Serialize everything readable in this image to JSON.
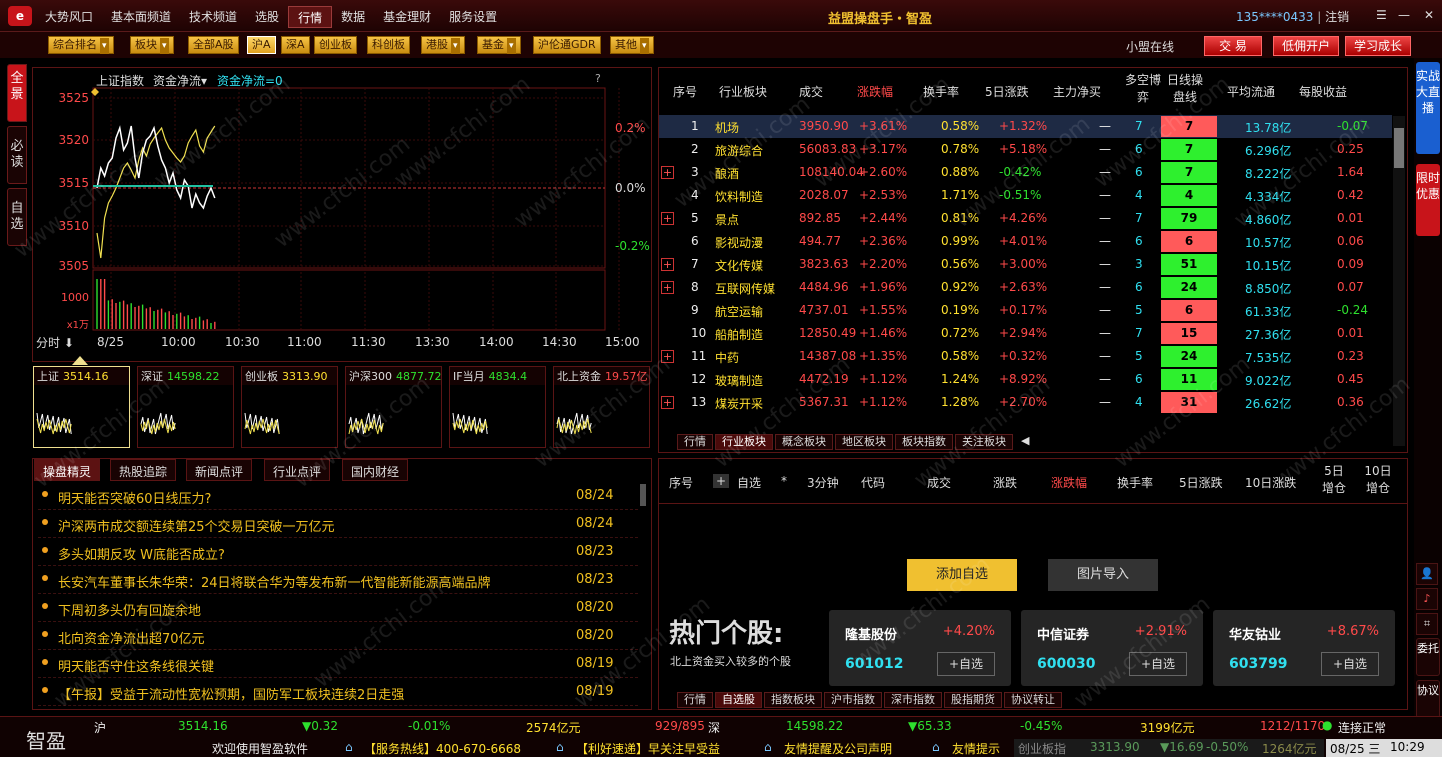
{
  "menu": [
    "大势风口",
    "基本面频道",
    "技术频道",
    "选股",
    "行情",
    "数据",
    "基金理财",
    "服务设置"
  ],
  "menu_active_index": 4,
  "app_title": "益盟操盘手・智盈",
  "user": {
    "account": "135****0433",
    "logout": "注销",
    "sep": "|"
  },
  "filters": [
    {
      "label": "综合排名",
      "arrow": true
    },
    {
      "label": "板块",
      "arrow": true
    },
    {
      "label": "全部A股",
      "arrow": false
    },
    {
      "label": "沪A",
      "arrow": false
    },
    {
      "label": "深A",
      "arrow": false
    },
    {
      "label": "创业板",
      "arrow": false
    },
    {
      "label": "科创板",
      "arrow": false
    },
    {
      "label": "港股",
      "arrow": true
    },
    {
      "label": "基金",
      "arrow": true
    },
    {
      "label": "沪伦通GDR",
      "arrow": false
    },
    {
      "label": "其他",
      "arrow": true
    }
  ],
  "top_right": {
    "online": "小盟在线",
    "trade": "交 易",
    "open": "低佣开户",
    "learn": "学习成长"
  },
  "left_tabs": [
    "全景",
    "必读",
    "自选"
  ],
  "chart": {
    "title": "上证指数",
    "indicator": "资金净流",
    "indicator_value": "资金净流=0",
    "help": "?",
    "y_left": [
      "3525",
      "3520",
      "3515",
      "3510",
      "3505"
    ],
    "y_right": [
      "0.2%",
      "0.0%",
      "-0.2%"
    ],
    "vol_label": "1000",
    "vol_unit": "x1万",
    "x_labels": [
      "8/25",
      "10:00",
      "10:30",
      "11:00",
      "11:30",
      "13:30",
      "14:00",
      "14:30",
      "15:00"
    ],
    "period": "分时"
  },
  "minis": [
    {
      "name": "上证",
      "value": "3514.16",
      "color": "#ffe030"
    },
    {
      "name": "深证",
      "value": "14598.22",
      "color": "#2ee02e"
    },
    {
      "name": "创业板",
      "value": "3313.90",
      "color": "#ffe030"
    },
    {
      "name": "沪深300",
      "value": "4877.72",
      "color": "#2ee02e"
    },
    {
      "name": "IF当月",
      "value": "4834.4",
      "color": "#2ee02e"
    },
    {
      "name": "北上资金",
      "value": "19.57亿",
      "color": "#ff4a4a"
    }
  ],
  "news_tabs": [
    "操盘精灵",
    "热股追踪",
    "新闻点评",
    "行业点评",
    "国内财经"
  ],
  "news": [
    {
      "title": "明天能否突破60日线压力?",
      "date": "08/24"
    },
    {
      "title": "沪深两市成交额连续第25个交易日突破一万亿元",
      "date": "08/24"
    },
    {
      "title": "多头如期反攻 W底能否成立?",
      "date": "08/23"
    },
    {
      "title": "长安汽车董事长朱华荣：24日将联合华为等发布新一代智能新能源高端品牌",
      "date": "08/23"
    },
    {
      "title": "下周初多头仍有回旋余地",
      "date": "08/20"
    },
    {
      "title": "北向资金净流出超70亿元",
      "date": "08/20"
    },
    {
      "title": "明天能否守住这条线很关键",
      "date": "08/19"
    },
    {
      "title": "【午报】受益于流动性宽松预期，国防军工板块连续2日走强",
      "date": "08/19"
    }
  ],
  "sector_headers": [
    "序号",
    "行业板块",
    "成交",
    "涨跌幅",
    "换手率",
    "5日涨跌",
    "主力净买",
    "多空博弈",
    "日线操盘线",
    "平均流通",
    "每股收益"
  ],
  "sectors": [
    {
      "no": "1",
      "name": "机场",
      "vol": "3950.90",
      "chg": "+3.61%",
      "turn": "0.58%",
      "d5": "+1.32%",
      "main": "—",
      "ls": "7",
      "line": "7",
      "lc": "red",
      "flow": "13.78亿",
      "eps": "-0.07",
      "plus": false
    },
    {
      "no": "2",
      "name": "旅游综合",
      "vol": "56083.83",
      "chg": "+3.17%",
      "turn": "0.78%",
      "d5": "+5.18%",
      "main": "—",
      "ls": "6",
      "line": "7",
      "lc": "grn",
      "flow": "6.296亿",
      "eps": "0.25",
      "plus": false
    },
    {
      "no": "3",
      "name": "酿酒",
      "vol": "108140.04",
      "chg": "+2.60%",
      "turn": "0.88%",
      "d5": "-0.42%",
      "main": "—",
      "ls": "6",
      "line": "7",
      "lc": "grn",
      "flow": "8.222亿",
      "eps": "1.64",
      "plus": true
    },
    {
      "no": "4",
      "name": "饮料制造",
      "vol": "2028.07",
      "chg": "+2.53%",
      "turn": "1.71%",
      "d5": "-0.51%",
      "main": "—",
      "ls": "4",
      "line": "4",
      "lc": "grn",
      "flow": "4.334亿",
      "eps": "0.42",
      "plus": false
    },
    {
      "no": "5",
      "name": "景点",
      "vol": "892.85",
      "chg": "+2.44%",
      "turn": "0.81%",
      "d5": "+4.26%",
      "main": "—",
      "ls": "7",
      "line": "79",
      "lc": "grn",
      "flow": "4.860亿",
      "eps": "0.01",
      "plus": true
    },
    {
      "no": "6",
      "name": "影视动漫",
      "vol": "494.77",
      "chg": "+2.36%",
      "turn": "0.99%",
      "d5": "+4.01%",
      "main": "—",
      "ls": "6",
      "line": "6",
      "lc": "red",
      "flow": "10.57亿",
      "eps": "0.06",
      "plus": false
    },
    {
      "no": "7",
      "name": "文化传媒",
      "vol": "3823.63",
      "chg": "+2.20%",
      "turn": "0.56%",
      "d5": "+3.00%",
      "main": "—",
      "ls": "3",
      "line": "51",
      "lc": "grn",
      "flow": "10.15亿",
      "eps": "0.09",
      "plus": true
    },
    {
      "no": "8",
      "name": "互联网传媒",
      "vol": "4484.96",
      "chg": "+1.96%",
      "turn": "0.92%",
      "d5": "+2.63%",
      "main": "—",
      "ls": "6",
      "line": "24",
      "lc": "grn",
      "flow": "8.850亿",
      "eps": "0.07",
      "plus": true
    },
    {
      "no": "9",
      "name": "航空运输",
      "vol": "4737.01",
      "chg": "+1.55%",
      "turn": "0.19%",
      "d5": "+0.17%",
      "main": "—",
      "ls": "5",
      "line": "6",
      "lc": "red",
      "flow": "61.33亿",
      "eps": "-0.24",
      "plus": false
    },
    {
      "no": "10",
      "name": "船舶制造",
      "vol": "12850.49",
      "chg": "+1.46%",
      "turn": "0.72%",
      "d5": "+2.94%",
      "main": "—",
      "ls": "7",
      "line": "15",
      "lc": "red",
      "flow": "27.36亿",
      "eps": "0.01",
      "plus": false
    },
    {
      "no": "11",
      "name": "中药",
      "vol": "14387.08",
      "chg": "+1.35%",
      "turn": "0.58%",
      "d5": "+0.32%",
      "main": "—",
      "ls": "5",
      "line": "24",
      "lc": "grn",
      "flow": "7.535亿",
      "eps": "0.23",
      "plus": true
    },
    {
      "no": "12",
      "name": "玻璃制造",
      "vol": "4472.19",
      "chg": "+1.12%",
      "turn": "1.24%",
      "d5": "+8.92%",
      "main": "—",
      "ls": "6",
      "line": "11",
      "lc": "grn",
      "flow": "9.022亿",
      "eps": "0.45",
      "plus": false
    },
    {
      "no": "13",
      "name": "煤炭开采",
      "vol": "5367.31",
      "chg": "+1.12%",
      "turn": "1.28%",
      "d5": "+2.70%",
      "main": "—",
      "ls": "4",
      "line": "31",
      "lc": "red",
      "flow": "26.62亿",
      "eps": "0.36",
      "plus": true
    }
  ],
  "sector_tabs": [
    "行情",
    "行业板块",
    "概念板块",
    "地区板块",
    "板块指数",
    "关注板块"
  ],
  "watch_headers": [
    "序号",
    "+",
    "自选",
    "*",
    "3分钟",
    "代码",
    "成交",
    "涨跌",
    "涨跌幅",
    "换手率",
    "5日涨跌",
    "10日涨跌",
    "5日增仓",
    "10日增仓"
  ],
  "watch_buttons": {
    "add": "添加自选",
    "import": "图片导入"
  },
  "hot": {
    "title": "热门个股:",
    "sub": "北上资金买入较多的个股",
    "stocks": [
      {
        "name": "隆基股份",
        "pct": "+4.20%",
        "code": "601012",
        "add": "+自选"
      },
      {
        "name": "中信证券",
        "pct": "+2.91%",
        "code": "600030",
        "add": "+自选"
      },
      {
        "name": "华友钴业",
        "pct": "+8.67%",
        "code": "603799",
        "add": "+自选"
      }
    ]
  },
  "watch_tabs": [
    "行情",
    "自选股",
    "指数板块",
    "沪市指数",
    "深市指数",
    "股指期货",
    "协议转让"
  ],
  "right_strip": {
    "live": "实战大直播",
    "promo": "限时优惠",
    "trust": "委托",
    "protocol": "协议"
  },
  "status": {
    "brand": "智盈",
    "sh": {
      "label": "沪",
      "val": "3514.16",
      "chg": "▼0.32",
      "pct": "-0.01%",
      "amt": "2574亿元",
      "updown": "929/895"
    },
    "sz": {
      "label": "深",
      "val": "14598.22",
      "chg": "▼65.33",
      "pct": "-0.45%",
      "amt": "3199亿元",
      "updown": "1212/1170"
    },
    "cy": {
      "label": "创业板指",
      "val": "3313.90",
      "chg": "▼16.69",
      "pct": "-0.50%",
      "amt": "1264亿元"
    },
    "conn": "连接正常",
    "welcome": "欢迎使用智盈软件",
    "hotline": "【服务热线】400-670-6668",
    "news1": "【利好速递】早关注早受益",
    "news2": "友情提醒及公司声明",
    "news3": "友情提示",
    "date": "08/25 三",
    "time": "10:29"
  },
  "watermark": "www.cfchi.com",
  "colors": {
    "up": "#ff4a4a",
    "down": "#2ee02e",
    "accent": "#f0c030"
  }
}
